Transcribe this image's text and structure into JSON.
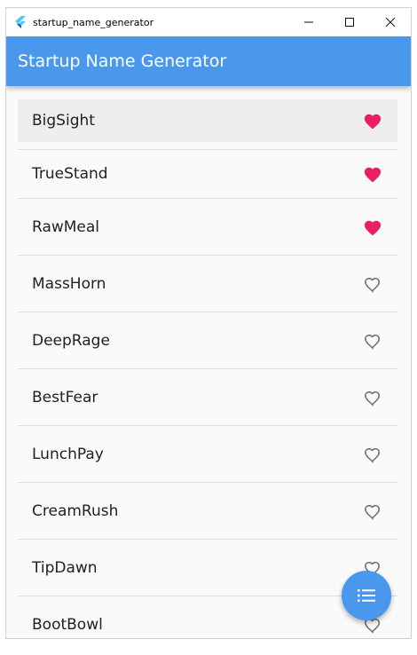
{
  "window": {
    "title": "startup_name_generator",
    "controls": {
      "minimize": "—",
      "maximize": "☐",
      "close": "✕"
    }
  },
  "appbar": {
    "title": "Startup Name Generator"
  },
  "list": {
    "items": [
      {
        "label": "BigSight",
        "saved": true
      },
      {
        "label": "TrueStand",
        "saved": true
      },
      {
        "label": "RawMeal",
        "saved": true
      },
      {
        "label": "MassHorn",
        "saved": false
      },
      {
        "label": "DeepRage",
        "saved": false
      },
      {
        "label": "BestFear",
        "saved": false
      },
      {
        "label": "LunchPay",
        "saved": false
      },
      {
        "label": "CreamRush",
        "saved": false
      },
      {
        "label": "TipDawn",
        "saved": false
      },
      {
        "label": "BootBowl",
        "saved": false
      }
    ]
  },
  "fab": {
    "icon": "list-icon"
  },
  "colors": {
    "accent": "#4a97ee",
    "heart_saved": "#e91e63",
    "heart_unsaved": "#757575"
  }
}
